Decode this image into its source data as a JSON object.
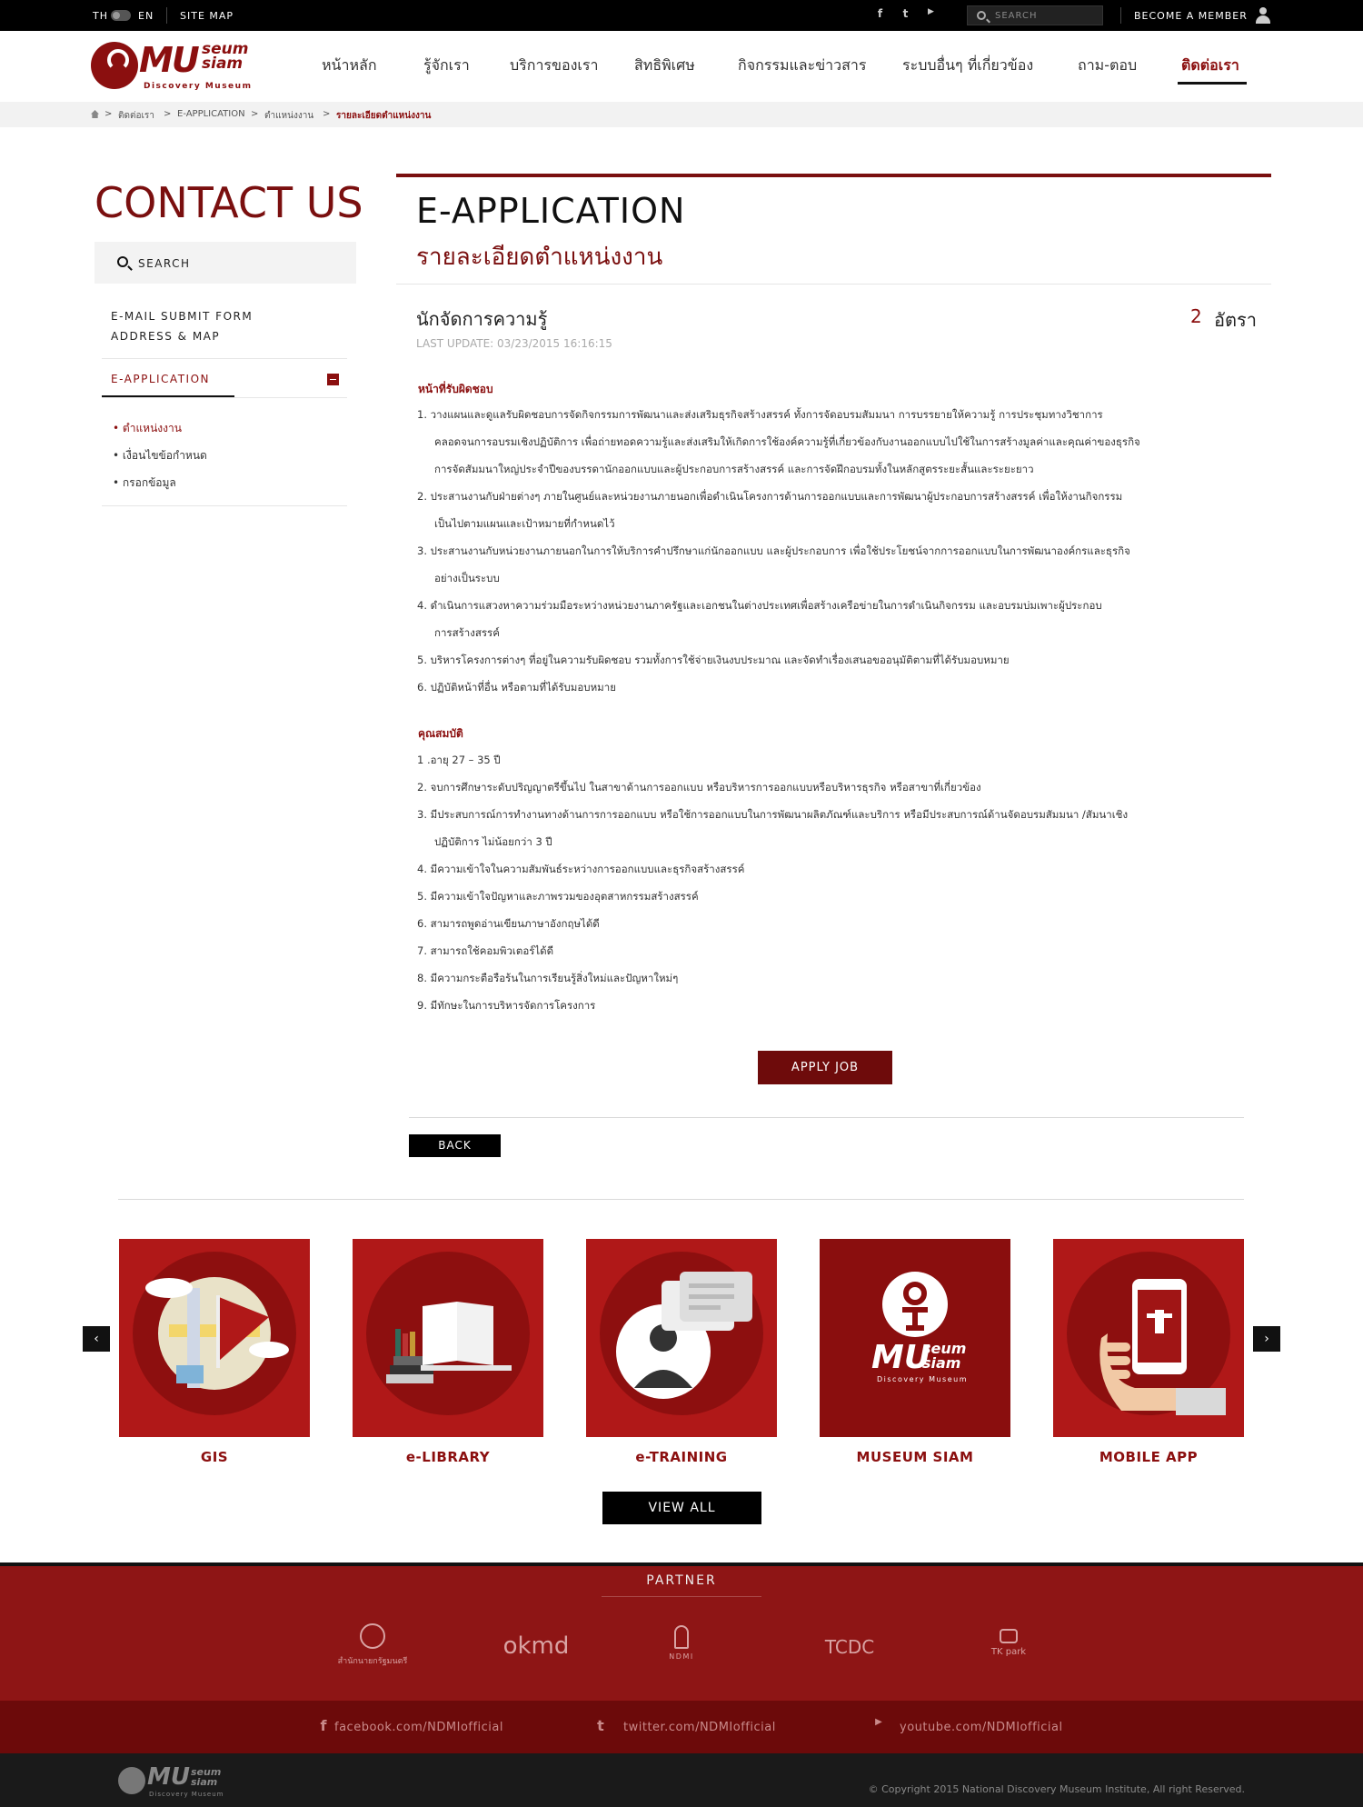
{
  "topbar": {
    "lang_th": "TH",
    "lang_en": "EN",
    "sitemap": "SITE MAP",
    "search_placeholder": "SEARCH",
    "member": "BECOME A MEMBER",
    "social": {
      "facebook": "f",
      "twitter": "t",
      "youtube": "yt"
    }
  },
  "logo": {
    "mu": "MU",
    "seum": "seum",
    "siam": "siam",
    "sub": "Discovery Museum"
  },
  "nav": [
    {
      "label": "หน้าหลัก"
    },
    {
      "label": "รู้จักเรา"
    },
    {
      "label": "บริการของเรา"
    },
    {
      "label": "สิทธิพิเศษ"
    },
    {
      "label": "กิจกรรมและข่าวสาร"
    },
    {
      "label": "ระบบอื่นๆ ที่เกี่ยวข้อง"
    },
    {
      "label": "ถาม-ตอบ"
    },
    {
      "label": "ติดต่อเรา"
    }
  ],
  "breadcrumb": [
    "ติดต่อเรา",
    "E-APPLICATION",
    "ตำแหน่งงาน",
    "รายละเอียดตำแหน่งงาน"
  ],
  "sidebar": {
    "title": "CONTACT US",
    "search": "SEARCH",
    "links": [
      "E-MAIL SUBMIT FORM",
      "ADDRESS & MAP"
    ],
    "active_section": "E-APPLICATION",
    "sub_items": [
      "ตำแหน่งงาน",
      "เงื่อนไขข้อกำหนด",
      "กรอกข้อมูล"
    ]
  },
  "main": {
    "title": "E-APPLICATION",
    "subtitle": "รายละเอียดตำแหน่งงาน",
    "job_title": "นักจัดการความรู้",
    "count": "2",
    "count_unit": "อัตรา",
    "last_update": "LAST UPDATE: 03/23/2015 16:16:15",
    "duties_heading": "หน้าที่รับผิดชอบ",
    "duties": [
      "1. วางแผนและดูแลรับผิดชอบการจัดกิจกรรมการพัฒนาและส่งเสริมธุรกิจสร้างสรรค์ ทั้งการจัดอบรมสัมมนา การบรรยายให้ความรู้ การประชุมทางวิชาการ",
      "คลอดจนการอบรมเชิงปฏิบัติการ เพื่อถ่ายทอดความรู้และส่งเสริมให้เกิดการใช้องค์ความรู้ที่เกี่ยวข้องกับงานออกแบบไปใช้ในการสร้างมูลค่าและคุณค่าของธุรกิจ",
      "การจัดสัมมนาใหญ่ประจำปีของบรรดานักออกแบบและผู้ประกอบการสร้างสรรค์ และการจัดฝึกอบรมทั้งในหลักสูตรระยะสั้นและระยะยาว",
      "2. ประสานงานกับฝ่ายต่างๆ ภายในศูนย์และหน่วยงานภายนอกเพื่อดำเนินโครงการด้านการออกแบบและการพัฒนาผู้ประกอบการสร้างสรรค์ เพื่อให้งานกิจกรรม",
      "เป็นไปตามแผนและเป้าหมายที่กำหนดไว้",
      "3. ประสานงานกับหน่วยงานภายนอกในการให้บริการคำปรึกษาแก่นักออกแบบ และผู้ประกอบการ เพื่อใช้ประโยชน์จากการออกแบบในการพัฒนาองค์กรและธุรกิจ",
      "อย่างเป็นระบบ",
      "4. ดำเนินการแสวงหาความร่วมมือระหว่างหน่วยงานภาครัฐและเอกชนในต่างประเทศเพื่อสร้างเครือข่ายในการดำเนินกิจกรรม และอบรมบ่มเพาะผู้ประกอบ",
      "การสร้างสรรค์",
      "5. บริหารโครงการต่างๆ ที่อยู่ในความรับผิดชอบ รวมทั้งการใช้จ่ายเงินงบประมาณ และจัดทำเรื่องเสนอขออนุมัติตามที่ได้รับมอบหมาย",
      "6. ปฏิบัติหน้าที่อื่น หรือตามที่ได้รับมอบหมาย"
    ],
    "qual_heading": "คุณสมบัติ",
    "quals": [
      "1 .อายุ 27 – 35 ปี",
      "2. จบการศึกษาระดับปริญญาตรีขึ้นไป ในสาขาด้านการออกแบบ หรือบริหารการออกแบบหรือบริหารธุรกิจ หรือสาขาที่เกี่ยวข้อง",
      "3. มีประสบการณ์การทำงานทางด้านการการออกแบบ หรือใช้การออกแบบในการพัฒนาผลิตภัณฑ์และบริการ หรือมีประสบการณ์ด้านจัดอบรมสัมมนา /สัมนาเชิง",
      "ปฏิบัติการ ไม่น้อยกว่า 3 ปี",
      "4. มีความเข้าใจในความสัมพันธ์ระหว่างการออกแบบและธุรกิจสร้างสรรค์",
      "5. มีความเข้าใจปัญหาและภาพรวมของอุตสาหกรรมสร้างสรรค์",
      "6. สามารถพูดอ่านเขียนภาษาอังกฤษได้ดี",
      "7. สามารถใช้คอมพิวเตอร์ได้ดี",
      "8. มีความกระตือรือร้นในการเรียนรู้สิ่งใหม่และปัญหาใหม่ๆ",
      "9. มีทักษะในการบริหารจัดการโครงการ"
    ],
    "apply": "APPLY JOB",
    "back": "BACK"
  },
  "services": {
    "tiles": [
      {
        "label": "GIS",
        "icon": "map-flag-icon"
      },
      {
        "label": "e-LIBRARY",
        "icon": "books-icon"
      },
      {
        "label": "e-TRAINING",
        "icon": "chat-person-icon"
      },
      {
        "label": "MUSEUM SIAM",
        "icon": "museum-logo-icon"
      },
      {
        "label": "MOBILE APP",
        "icon": "phone-hand-icon"
      }
    ],
    "prev": "‹",
    "next": "›",
    "view_all": "VIEW ALL"
  },
  "footer": {
    "partner_label": "PARTNER",
    "partners": [
      "สำนักนายกรัฐมนตรี",
      "okmd",
      "NDMI",
      "TCDC",
      "TK park"
    ],
    "social": [
      "facebook.com/NDMIofficial",
      "twitter.com/NDMIofficial",
      "youtube.com/NDMIofficial"
    ],
    "copyright": "© Copyright 2015 National Discovery Museum Institute, All right Reserved."
  },
  "colors": {
    "brand": "#8b0f0f",
    "tile": "#b01818",
    "footer": "#8e1515"
  }
}
